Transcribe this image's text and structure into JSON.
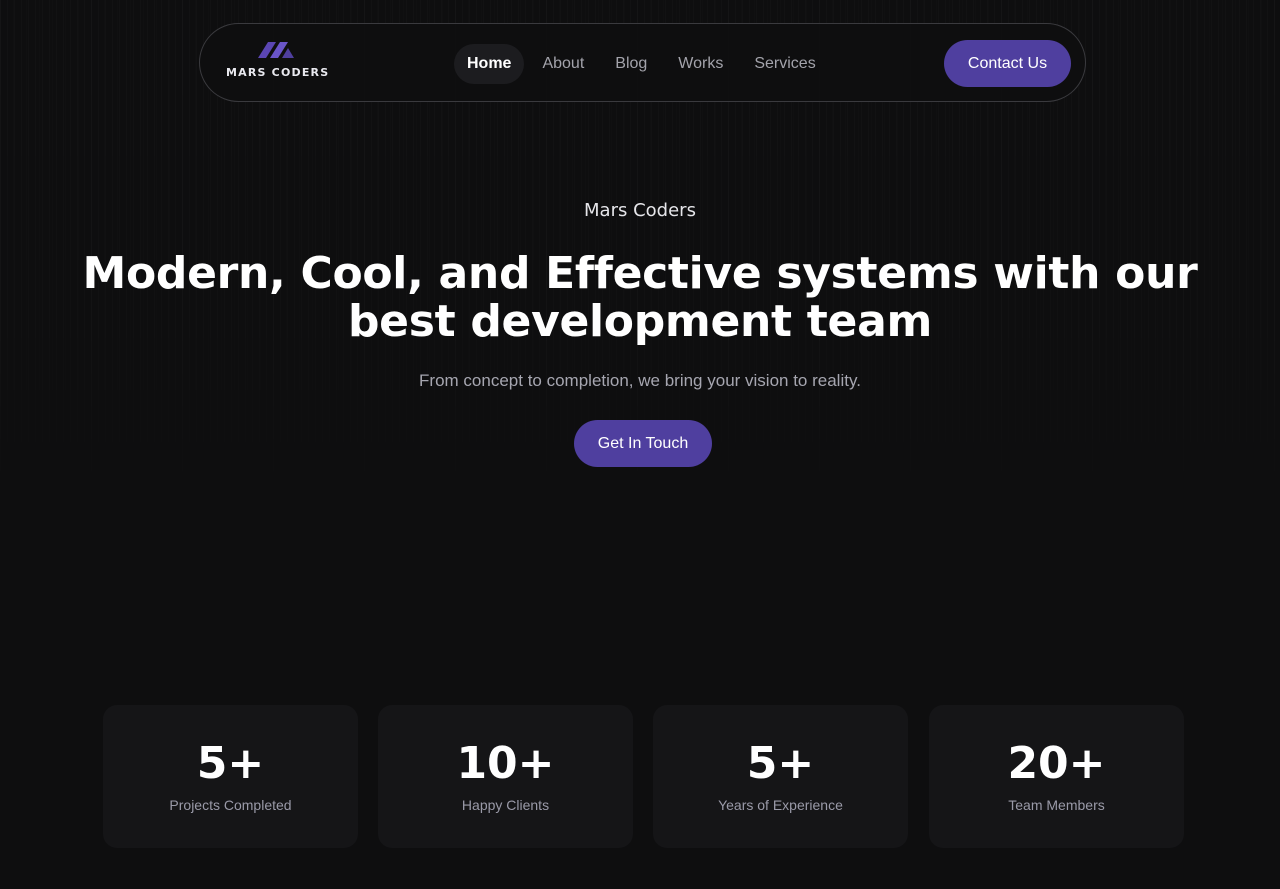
{
  "brand": {
    "name": "MARS CODERS",
    "accent_color": "#4f3f9f",
    "logo_icon": "mars-coders-logo-icon"
  },
  "nav": {
    "items": [
      {
        "label": "Home",
        "active": true
      },
      {
        "label": "About",
        "active": false
      },
      {
        "label": "Blog",
        "active": false
      },
      {
        "label": "Works",
        "active": false
      },
      {
        "label": "Services",
        "active": false
      }
    ],
    "contact_label": "Contact Us"
  },
  "hero": {
    "eyebrow": "Mars Coders",
    "title": "Modern, Cool, and Effective systems with our best development team",
    "subtitle": "From concept to completion, we bring your vision to reality.",
    "cta_label": "Get In Touch"
  },
  "stats": [
    {
      "value": "5+",
      "label": "Projects Completed"
    },
    {
      "value": "10+",
      "label": "Happy Clients"
    },
    {
      "value": "5+",
      "label": "Years of Experience"
    },
    {
      "value": "20+",
      "label": "Team Members"
    }
  ]
}
